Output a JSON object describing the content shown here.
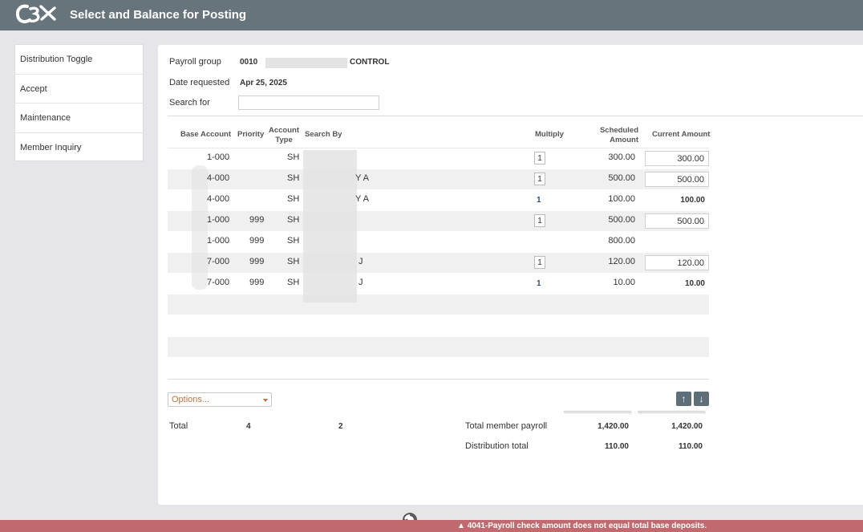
{
  "header": {
    "title": "Select and Balance for Posting",
    "logo_text": "CBX"
  },
  "sidebar": {
    "items": [
      {
        "label": "Distribution Toggle"
      },
      {
        "label": "Accept"
      },
      {
        "label": "Maintenance"
      },
      {
        "label": "Member Inquiry"
      }
    ]
  },
  "form": {
    "payroll_group_label": "Payroll group",
    "payroll_group_code": "0010",
    "payroll_group_name": "CONTROL",
    "date_requested_label": "Date requested",
    "date_requested_value": "Apr 25, 2025",
    "search_label": "Search for",
    "search_value": ""
  },
  "table": {
    "headers": {
      "base_account": "Base Account",
      "priority": "Priority",
      "account_type": "Account Type",
      "search_by": "Search By",
      "multiply": "Multiply",
      "scheduled_amount": "Scheduled Amount",
      "current_amount": "Current Amount"
    },
    "rows": [
      {
        "base_account": "1-000",
        "priority": "",
        "account_type": "SH",
        "search_by": "",
        "multiply": "1",
        "scheduled": "300.00",
        "current": "300.00"
      },
      {
        "base_account": "4-000",
        "priority": "",
        "account_type": "SH",
        "search_by": "Y A",
        "multiply": "1",
        "scheduled": "500.00",
        "current": "500.00"
      },
      {
        "base_account": "4-000",
        "priority": "",
        "account_type": "SH",
        "search_by": "Y A",
        "multiply": "1",
        "scheduled": "100.00",
        "current": "100.00"
      },
      {
        "base_account": "1-000",
        "priority": "999",
        "account_type": "SH",
        "search_by": "",
        "multiply": "1",
        "scheduled": "500.00",
        "current": "500.00"
      },
      {
        "base_account": "1-000",
        "priority": "999",
        "account_type": "SH",
        "search_by": "",
        "multiply": "",
        "scheduled": "800.00",
        "current": ""
      },
      {
        "base_account": "7-000",
        "priority": "999",
        "account_type": "SH",
        "search_by": "J",
        "multiply": "1",
        "scheduled": "120.00",
        "current": "120.00"
      },
      {
        "base_account": "7-000",
        "priority": "999",
        "account_type": "SH",
        "search_by": "J",
        "multiply": "1",
        "scheduled": "10.00",
        "current": "10.00"
      }
    ]
  },
  "options": {
    "label": "Options..."
  },
  "totals": {
    "total_label": "Total",
    "count1": "4",
    "count2": "2",
    "member_payroll_label": "Total member payroll",
    "member_payroll_scheduled": "1,420.00",
    "member_payroll_current": "1,420.00",
    "distribution_label": "Distribution total",
    "distribution_scheduled": "110.00",
    "distribution_current": "110.00"
  },
  "error": {
    "message": "4041-Payroll check amount does not equal total base deposits.",
    "color": "#c06a6f"
  },
  "colors": {
    "header": "#67747b",
    "accent": "#c26f3b"
  }
}
